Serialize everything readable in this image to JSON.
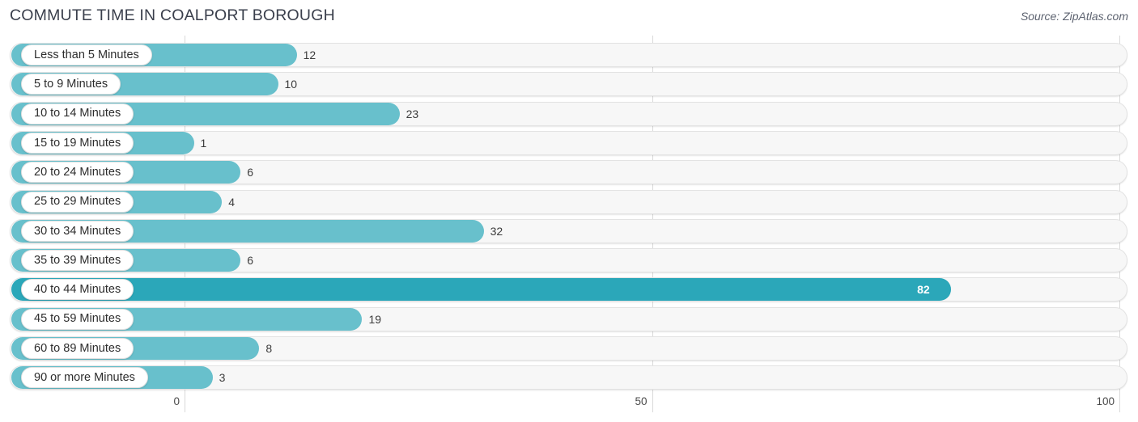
{
  "header": {
    "title": "COMMUTE TIME IN COALPORT BOROUGH",
    "source": "Source: ZipAtlas.com"
  },
  "chart_data": {
    "type": "bar",
    "orientation": "horizontal",
    "title": "COMMUTE TIME IN COALPORT BOROUGH",
    "xlabel": "",
    "ylabel": "",
    "xlim": [
      0,
      100
    ],
    "xticks": [
      0,
      50,
      100
    ],
    "xtick_labels": [
      "0",
      "50",
      "100"
    ],
    "grid": true,
    "legend": "none",
    "categories": [
      "Less than 5 Minutes",
      "5 to 9 Minutes",
      "10 to 14 Minutes",
      "15 to 19 Minutes",
      "20 to 24 Minutes",
      "25 to 29 Minutes",
      "30 to 34 Minutes",
      "35 to 39 Minutes",
      "40 to 44 Minutes",
      "45 to 59 Minutes",
      "60 to 89 Minutes",
      "90 or more Minutes"
    ],
    "values": [
      12,
      10,
      23,
      1,
      6,
      4,
      32,
      6,
      82,
      19,
      8,
      3
    ],
    "value_labels": [
      "12",
      "10",
      "23",
      "1",
      "6",
      "4",
      "32",
      "6",
      "82",
      "19",
      "8",
      "3"
    ],
    "highlight_index": 8,
    "colors": {
      "bar": "#68c0cc",
      "bar_highlight": "#2ba7b9",
      "track": "#f7f7f7",
      "track_border": "#e3e3e3",
      "gridline": "#d9d9d9",
      "title_text": "#3a3f4c",
      "label_text": "#2d2d2d",
      "value_text": "#3c3c3c",
      "value_text_inside": "#ffffff"
    }
  }
}
